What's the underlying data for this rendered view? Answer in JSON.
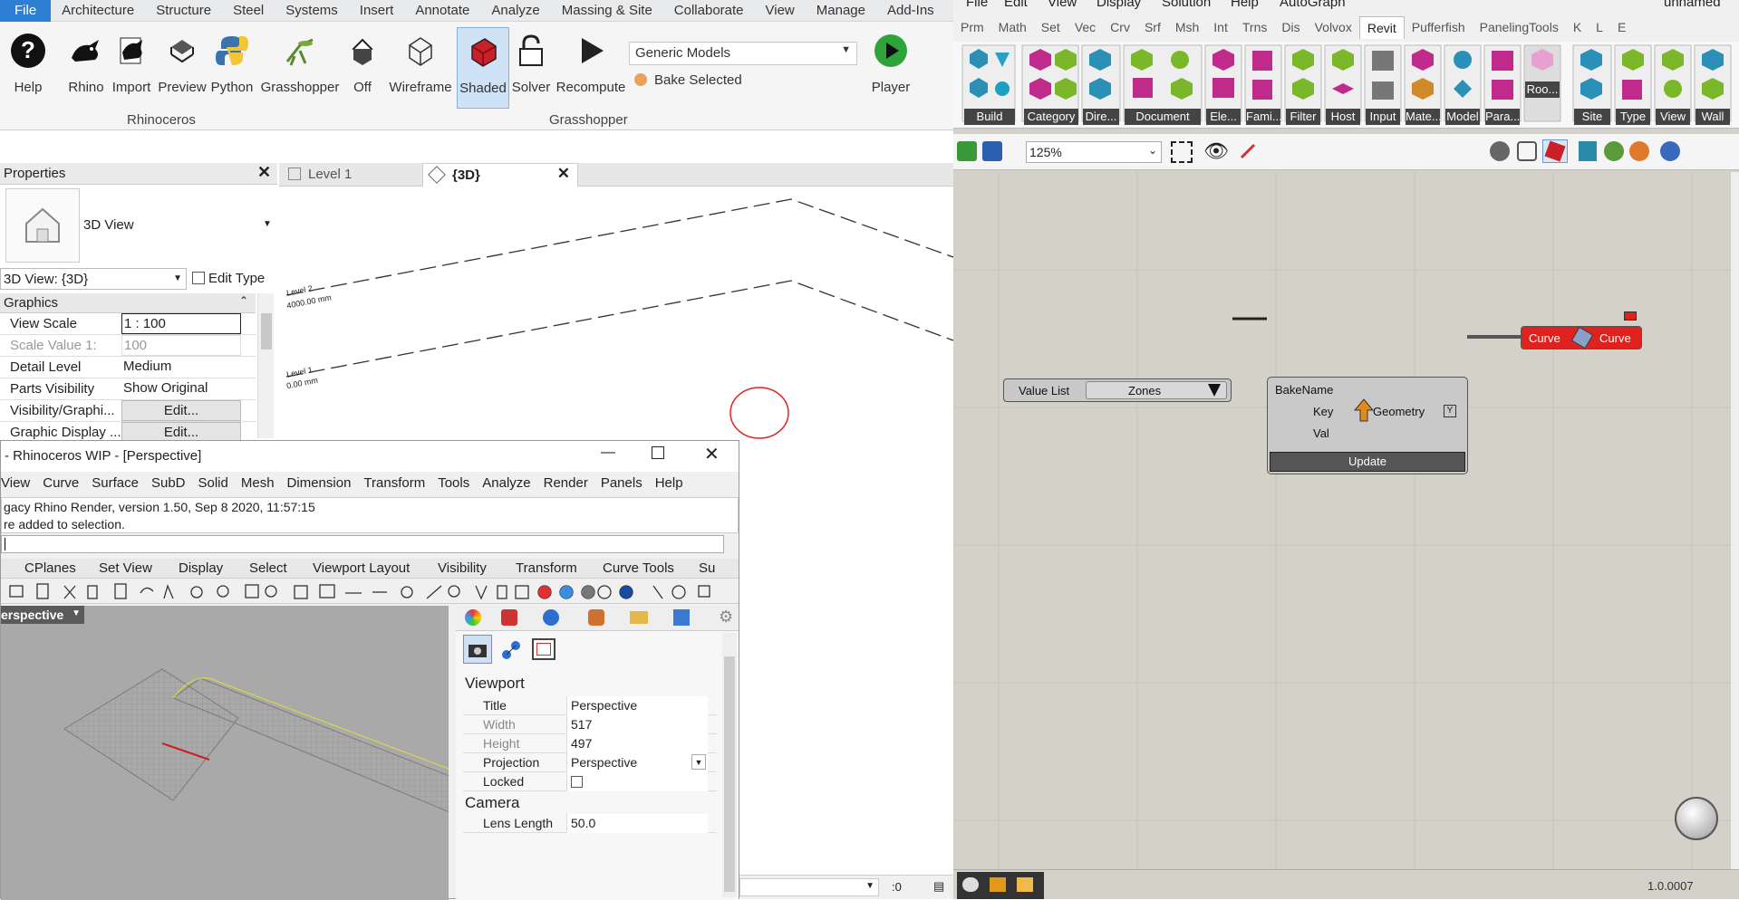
{
  "revit": {
    "tabs": [
      "File",
      "Architecture",
      "Structure",
      "Steel",
      "Systems",
      "Insert",
      "Annotate",
      "Analyze",
      "Massing & Site",
      "Collaborate",
      "View",
      "Manage",
      "Add-Ins"
    ],
    "ribbon": {
      "buttons": [
        {
          "label": "Help"
        },
        {
          "label": "Rhino"
        },
        {
          "label": "Import"
        },
        {
          "label": "Preview"
        },
        {
          "label": "Python"
        },
        {
          "label": "Grasshopper"
        },
        {
          "label": "Off"
        },
        {
          "label": "Wireframe"
        },
        {
          "label": "Shaded"
        },
        {
          "label": "Solver"
        },
        {
          "label": "Recompute"
        },
        {
          "label": "Player"
        }
      ],
      "category_select": "Generic Models",
      "bake_selected": "Bake Selected",
      "panel_rhinoceros": "Rhinoceros",
      "panel_grasshopper": "Grasshopper"
    },
    "properties": {
      "title": "Properties",
      "type_name": "3D View",
      "view_selector": "3D View: {3D}",
      "edit_type": "Edit Type",
      "section": "Graphics",
      "rows": [
        {
          "key": "View Scale",
          "value": "1 : 100"
        },
        {
          "key": "Scale Value    1:",
          "value": "100"
        },
        {
          "key": "Detail Level",
          "value": "Medium"
        },
        {
          "key": "Parts Visibility",
          "value": "Show Original"
        },
        {
          "key": "Visibility/Graphi...",
          "value": "Edit..."
        },
        {
          "key": "Graphic Display ...",
          "value": "Edit..."
        }
      ]
    },
    "view_tabs": [
      {
        "label": "Level 1"
      },
      {
        "label": "{3D}"
      }
    ],
    "levels": [
      {
        "name": "Level 2",
        "elev": "4000.00 mm"
      },
      {
        "name": "Level 1",
        "elev": "0.00 mm"
      }
    ]
  },
  "rhino": {
    "title": "- Rhinoceros WIP - [Perspective]",
    "menu": [
      "View",
      "Curve",
      "Surface",
      "SubD",
      "Solid",
      "Mesh",
      "Dimension",
      "Transform",
      "Tools",
      "Analyze",
      "Render",
      "Panels",
      "Help"
    ],
    "history": [
      "gacy Rhino Render, version 1.50, Sep  8 2020, 11:57:15",
      "re added to selection."
    ],
    "toolbar_tabs": [
      "CPlanes",
      "Set View",
      "Display",
      "Select",
      "Viewport Layout",
      "Visibility",
      "Transform",
      "Curve Tools",
      "Su"
    ],
    "viewport_label": "erspective",
    "panel": {
      "section": "Viewport",
      "rows": [
        {
          "key": "Title",
          "value": "Perspective"
        },
        {
          "key": "Width",
          "value": "517"
        },
        {
          "key": "Height",
          "value": "497"
        },
        {
          "key": "Projection",
          "value": "Perspective"
        },
        {
          "key": "Locked",
          "value": ""
        }
      ],
      "camera_section": "Camera",
      "lens_key": "Lens Length",
      "lens_value": "50.0"
    },
    "status": ":0"
  },
  "gh": {
    "menu": [
      "File",
      "Edit",
      "View",
      "Display",
      "Solution",
      "Help",
      "AutoGraph"
    ],
    "doc_name": "unnamed",
    "tabs": [
      "Prm",
      "Math",
      "Set",
      "Vec",
      "Crv",
      "Srf",
      "Msh",
      "Int",
      "Trns",
      "Dis",
      "Volvox",
      "Revit",
      "Pufferfish",
      "PanelingTools",
      "K",
      "L",
      "E"
    ],
    "groups": [
      "Build",
      "Category",
      "Dire...",
      "Document",
      "Ele...",
      "Fami...",
      "Filter",
      "Host",
      "Input",
      "Mate...",
      "Model",
      "Para...",
      "Roo...",
      "Site",
      "Type",
      "View",
      "Wall"
    ],
    "zoom": "125%",
    "value_list": {
      "label": "Value List",
      "value": "Zones"
    },
    "bake": {
      "inputs": [
        "BakeName",
        "Key",
        "Val"
      ],
      "output": "Geometry",
      "button": "Update"
    },
    "curve": {
      "in": "Curve",
      "out": "Curve"
    },
    "version": "1.0.0007"
  }
}
